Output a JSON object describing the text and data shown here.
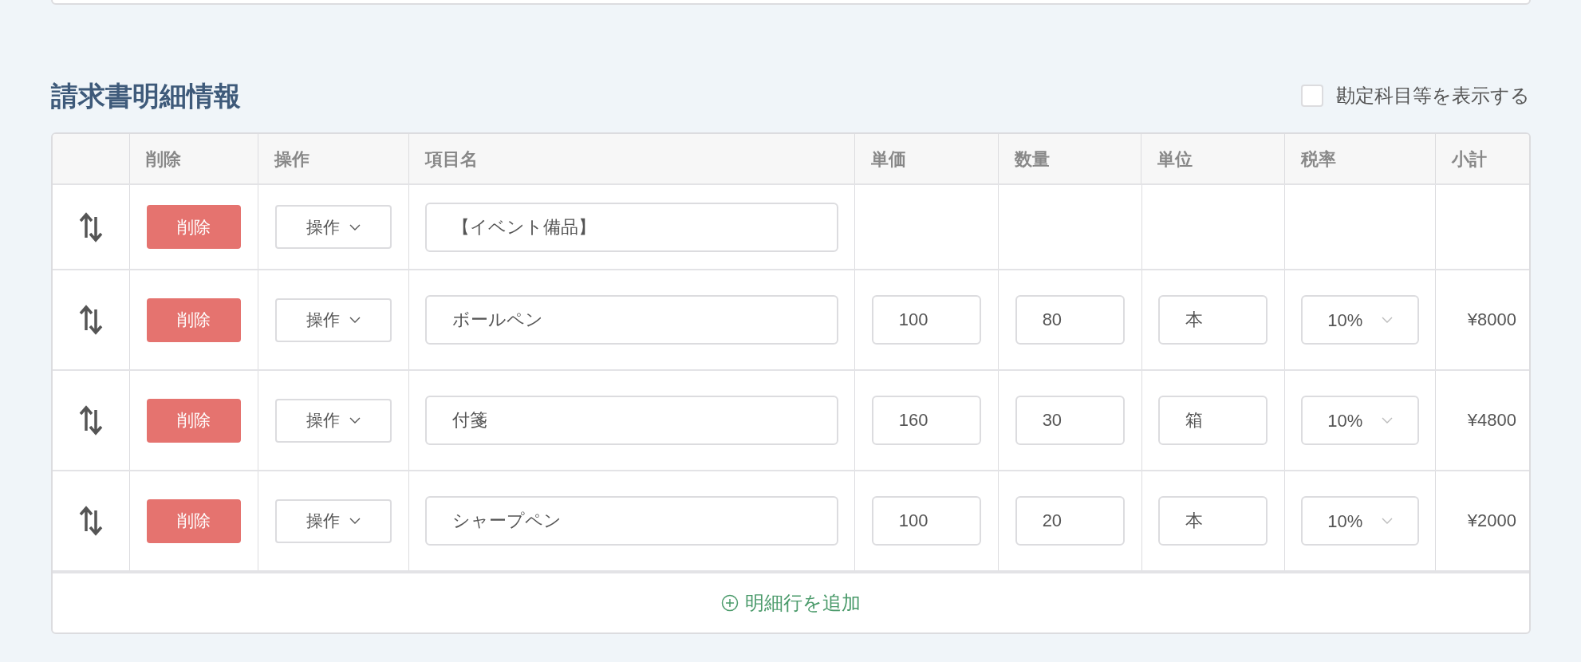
{
  "section": {
    "title": "請求書明細情報",
    "show_accounts": {
      "label": "勘定科目等を表示する",
      "checked": false
    }
  },
  "table": {
    "columns": [
      "",
      "削除",
      "操作",
      "項目名",
      "単価",
      "数量",
      "単位",
      "税率",
      "小計"
    ],
    "rows": [
      {
        "kind": "heading",
        "delete": "削除",
        "action": "操作",
        "name": "【イベント備品】"
      },
      {
        "kind": "item",
        "delete": "削除",
        "action": "操作",
        "name": "ボールペン",
        "price": "100",
        "quantity": "80",
        "unit": "本",
        "tax": "10%",
        "subtotal": "¥8000"
      },
      {
        "kind": "item",
        "delete": "削除",
        "action": "操作",
        "name": "付箋",
        "price": "160",
        "quantity": "30",
        "unit": "箱",
        "tax": "10%",
        "subtotal": "¥4800"
      },
      {
        "kind": "item",
        "delete": "削除",
        "action": "操作",
        "name": "シャープペン",
        "price": "100",
        "quantity": "20",
        "unit": "本",
        "tax": "10%",
        "subtotal": "¥2000"
      }
    ],
    "add_row": "明細行を追加"
  }
}
